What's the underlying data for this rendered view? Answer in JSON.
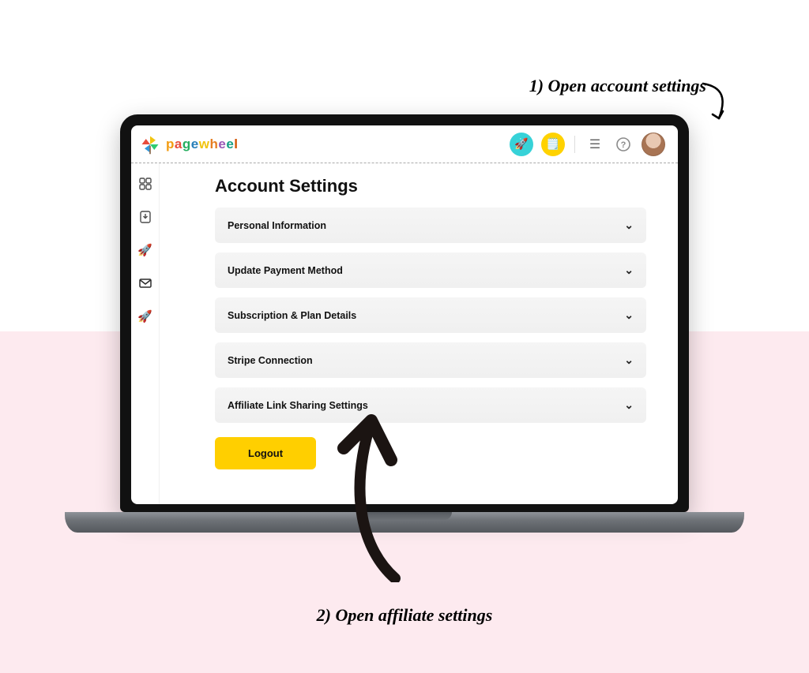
{
  "annotations": {
    "step1": "1) Open account settings",
    "step2": "2) Open affiliate settings"
  },
  "brand": {
    "name": "pagewheel"
  },
  "page": {
    "title": "Account Settings",
    "sections": [
      {
        "label": "Personal Information"
      },
      {
        "label": "Update Payment Method"
      },
      {
        "label": "Subscription & Plan Details"
      },
      {
        "label": "Stripe Connection"
      },
      {
        "label": "Affiliate Link Sharing Settings"
      }
    ],
    "logout_label": "Logout"
  }
}
